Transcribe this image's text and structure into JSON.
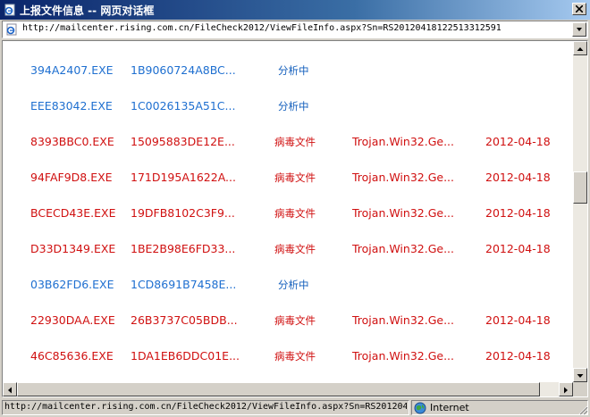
{
  "window": {
    "title": "上报文件信息 -- 网页对话框"
  },
  "address": {
    "url": "http://mailcenter.rising.com.cn/FileCheck2012/ViewFileInfo.aspx?Sn=RS20120418122513312591"
  },
  "table": {
    "rows": [
      {
        "type": "pending",
        "name": "394A2407.EXE",
        "hash": "1B9060724A8BC...",
        "status": "分析中",
        "virus": "",
        "date": ""
      },
      {
        "type": "pending",
        "name": "EEE83042.EXE",
        "hash": "1C0026135A51C...",
        "status": "分析中",
        "virus": "",
        "date": ""
      },
      {
        "type": "virus",
        "name": "8393BBC0.EXE",
        "hash": "15095883DE12E...",
        "status": "病毒文件",
        "virus": "Trojan.Win32.Ge...",
        "date": "2012-04-18"
      },
      {
        "type": "virus",
        "name": "94FAF9D8.EXE",
        "hash": "171D195A1622A...",
        "status": "病毒文件",
        "virus": "Trojan.Win32.Ge...",
        "date": "2012-04-18"
      },
      {
        "type": "virus",
        "name": "BCECD43E.EXE",
        "hash": "19DFB8102C3F9...",
        "status": "病毒文件",
        "virus": "Trojan.Win32.Ge...",
        "date": "2012-04-18"
      },
      {
        "type": "virus",
        "name": "D33D1349.EXE",
        "hash": "1BE2B98E6FD33...",
        "status": "病毒文件",
        "virus": "Trojan.Win32.Ge...",
        "date": "2012-04-18"
      },
      {
        "type": "pending",
        "name": "03B62FD6.EXE",
        "hash": "1CD8691B7458E...",
        "status": "分析中",
        "virus": "",
        "date": ""
      },
      {
        "type": "virus",
        "name": "22930DAA.EXE",
        "hash": "26B3737C05BDB...",
        "status": "病毒文件",
        "virus": "Trojan.Win32.Ge...",
        "date": "2012-04-18"
      },
      {
        "type": "virus",
        "name": "46C85636.EXE",
        "hash": "1DA1EB6DDC01E...",
        "status": "病毒文件",
        "virus": "Trojan.Win32.Ge...",
        "date": "2012-04-18"
      }
    ]
  },
  "statusbar": {
    "url": "http://mailcenter.rising.com.cn/FileCheck2012/ViewFileInfo.aspx?Sn=RS201204",
    "zone": "Internet"
  },
  "icons": {
    "app": "ie-page-icon",
    "close": "close-icon",
    "dropdown": "chevron-down-icon",
    "scroll_up": "arrow-up-icon",
    "scroll_down": "arrow-down-icon",
    "scroll_left": "arrow-left-icon",
    "scroll_right": "arrow-right-icon",
    "zone": "globe-icon",
    "grip": "resize-grip-icon"
  },
  "colors": {
    "pending": "#1e6fd0",
    "virus": "#d01010",
    "titlebar": "#0a246a"
  }
}
